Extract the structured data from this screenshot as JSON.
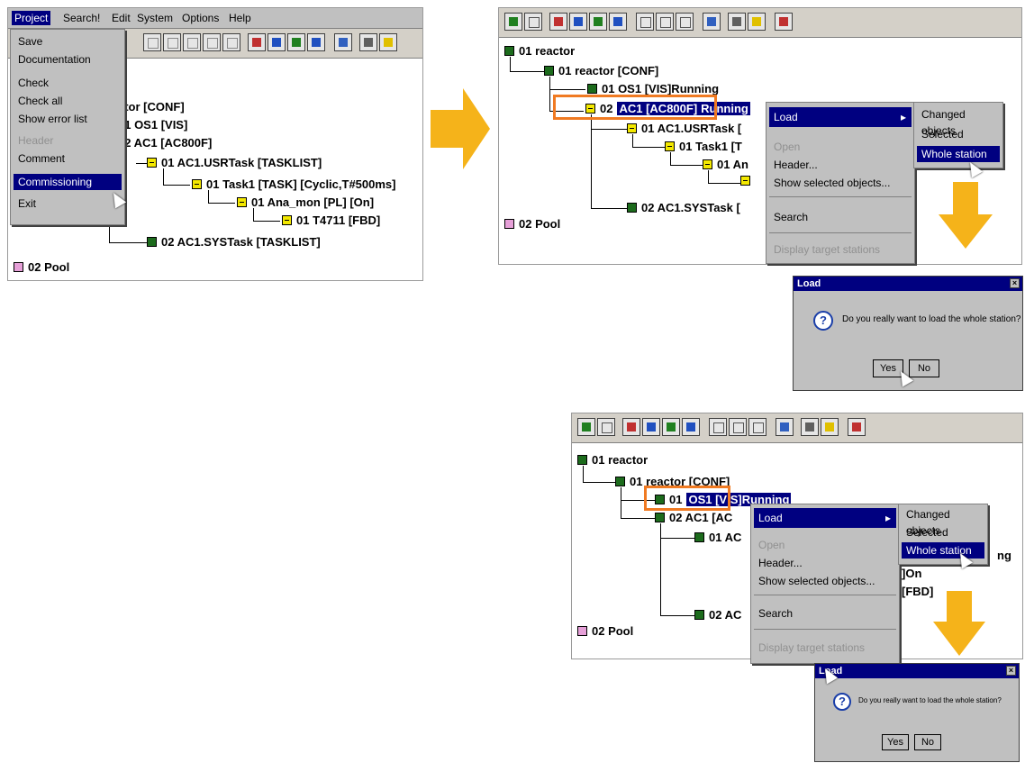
{
  "panel1": {
    "menubar": [
      "Project",
      "Search!",
      "Edit",
      "System",
      "Options",
      "Help"
    ],
    "menu_items": [
      "Save",
      "Documentation",
      "Check",
      "Check all",
      "Show error list",
      "Header",
      "Comment",
      "Commissioning",
      "Exit"
    ],
    "tree": {
      "conf": "ctor  [CONF]",
      "os1": "01  OS1  [VIS]",
      "ac1": "02  AC1  [AC800F]",
      "usrtask": "01  AC1.USRTask  [TASKLIST]",
      "task1": "01  Task1  [TASK]  [Cyclic,T#500ms]",
      "anamon": "01  Ana_mon  [PL]  [On]",
      "t4711": "01  T4711  [FBD]",
      "systask": "02  AC1.SYSTask  [TASKLIST]",
      "pool": "02  Pool"
    }
  },
  "panel2": {
    "tree": {
      "reactor": "01  reactor",
      "conf": "01  reactor  [CONF]",
      "os1": "01  OS1  [VIS]Running",
      "ac1_prefix": "02",
      "ac1_sel": "AC1  [AC800F]",
      "ac1_suffix": "Running",
      "usrtask": "01  AC1.USRTask  [",
      "task1": "01  Task1  [T",
      "anamon": "01  An",
      "systask": "02  AC1.SYSTask  [",
      "pool": "02  Pool"
    },
    "context_menu": [
      "Load",
      "Open",
      "Header...",
      "Show selected objects...",
      "Search",
      "Display target stations"
    ],
    "submenu": [
      "Changed objects",
      "Selected objects",
      "Whole station"
    ],
    "dialog": {
      "title": "Load",
      "message": "Do you really want to load the whole station?",
      "yes": "Yes",
      "no": "No"
    }
  },
  "panel3": {
    "tree": {
      "reactor": "01  reactor",
      "conf": "01  reactor  [CONF]",
      "os1_prefix": "01",
      "os1_sel": "OS1  [VIS]Running",
      "ac1": "02  AC1  [AC",
      "usrtask": "01  AC",
      "t_on": "]On",
      "t_fbd": "[FBD]",
      "ng": "ng",
      "systask": "02  AC",
      "pool": "02  Pool"
    },
    "context_menu": [
      "Load",
      "Open",
      "Header...",
      "Show selected objects...",
      "Search",
      "Display target stations"
    ],
    "submenu": [
      "Changed objects",
      "Selected objects",
      "Whole station"
    ],
    "dialog": {
      "title": "Load",
      "message": "Do you really want to load the whole station?",
      "yes": "Yes",
      "no": "No"
    }
  },
  "colors": {
    "arrow": "#f5b31a",
    "highlight_box": "#f07a22",
    "selection": "#000080"
  }
}
